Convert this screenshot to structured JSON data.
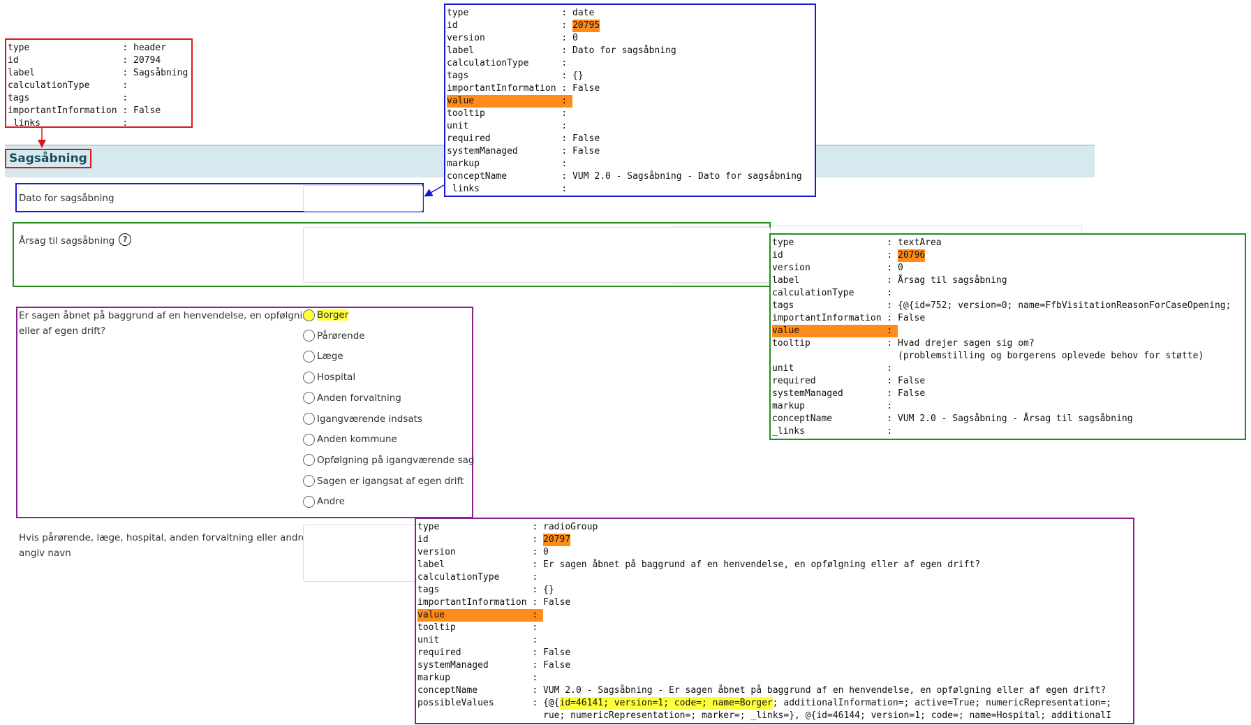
{
  "header_panel": {
    "rows": [
      {
        "k": "type",
        "v": "header"
      },
      {
        "k": "id",
        "v": "20794"
      },
      {
        "k": "label",
        "v": "Sagsåbning"
      },
      {
        "k": "calculationType",
        "v": ""
      },
      {
        "k": "tags",
        "v": ""
      },
      {
        "k": "importantInformation",
        "v": "False"
      },
      {
        "k": " links",
        "v": ""
      }
    ]
  },
  "form": {
    "header_title": "Sagsåbning",
    "date_label": "Dato for sagsåbning",
    "reason_label": "Årsag til sagsåbning",
    "help_glyph": "?",
    "question_label_1": "Er sagen åbnet på baggrund af en henvendelse, en opfølgning",
    "question_label_2": "eller af egen drift?",
    "radio_options": [
      "Borger",
      "Pårørende",
      "Læge",
      "Hospital",
      "Anden forvaltning",
      "Igangværende indsats",
      "Anden kommune",
      "Opfølgning på igangværende sag",
      "Sagen er igangsat af egen drift",
      "Andre"
    ],
    "name_label_1": "Hvis pårørende, læge, hospital, anden forvaltning eller andre -",
    "name_label_2": "angiv navn"
  },
  "date_panel": {
    "rows": [
      {
        "k": "type",
        "v": "date"
      },
      {
        "k": "id",
        "v": "20795"
      },
      {
        "k": "version",
        "v": "0"
      },
      {
        "k": "label",
        "v": "Dato for sagsåbning"
      },
      {
        "k": "calculationType",
        "v": ""
      },
      {
        "k": "tags",
        "v": "{}"
      },
      {
        "k": "importantInformation",
        "v": "False"
      },
      {
        "k": "value",
        "v": ""
      },
      {
        "k": "tooltip",
        "v": ""
      },
      {
        "k": "unit",
        "v": ""
      },
      {
        "k": "required",
        "v": "False"
      },
      {
        "k": "systemManaged",
        "v": "False"
      },
      {
        "k": "markup",
        "v": ""
      },
      {
        "k": "conceptName",
        "v": "VUM 2.0 - Sagsåbning - Dato for sagsåbning"
      },
      {
        "k": " links",
        "v": ""
      }
    ]
  },
  "textarea_panel": {
    "rows": [
      {
        "k": "type",
        "v": "textArea"
      },
      {
        "k": "id",
        "v": "20796"
      },
      {
        "k": "version",
        "v": "0"
      },
      {
        "k": "label",
        "v": "Årsag til sagsåbning"
      },
      {
        "k": "calculationType",
        "v": ""
      },
      {
        "k": "tags",
        "v": "{@{id=752; version=0; name=FfbVisitationReasonForCaseOpening;"
      },
      {
        "k": "importantInformation",
        "v": "False"
      },
      {
        "k": "value",
        "v": ""
      },
      {
        "k": "tooltip",
        "v": "Hvad drejer sagen sig om?"
      },
      {
        "k": "",
        "v": "(problemstilling og borgerens oplevede behov for støtte)"
      },
      {
        "k": "unit",
        "v": ""
      },
      {
        "k": "required",
        "v": "False"
      },
      {
        "k": "systemManaged",
        "v": "False"
      },
      {
        "k": "markup",
        "v": ""
      },
      {
        "k": "conceptName",
        "v": "VUM 2.0 - Sagsåbning - Årsag til sagsåbning"
      },
      {
        "k": "_links",
        "v": ""
      }
    ]
  },
  "radio_panel": {
    "rows": [
      {
        "k": "type",
        "v": "radioGroup"
      },
      {
        "k": "id",
        "v": "20797"
      },
      {
        "k": "version",
        "v": "0"
      },
      {
        "k": "label",
        "v": "Er sagen åbnet på baggrund af en henvendelse, en opfølgning eller af egen drift?"
      },
      {
        "k": "calculationType",
        "v": ""
      },
      {
        "k": "tags",
        "v": "{}"
      },
      {
        "k": "importantInformation",
        "v": "False"
      },
      {
        "k": "value",
        "v": ""
      },
      {
        "k": "tooltip",
        "v": ""
      },
      {
        "k": "unit",
        "v": ""
      },
      {
        "k": "required",
        "v": "False"
      },
      {
        "k": "systemManaged",
        "v": "False"
      },
      {
        "k": "markup",
        "v": ""
      },
      {
        "k": "conceptName",
        "v": "VUM 2.0 - Sagsåbning - Er sagen åbnet på baggrund af en henvendelse, en opfølgning eller af egen drift?"
      }
    ],
    "possible_key": "possibleValues",
    "possible_prefix": "{@{",
    "possible_highlight": "id=46141; version=1; code=; name=Borger",
    "possible_rest": "; additionalInformation=; active=True; numericRepresentation=;",
    "possible_line2": "rue; numericRepresentation=; marker=; _links=}, @{id=46144; version=1; code=; name=Hospital; additionalI"
  },
  "colors": {
    "red": "#e0141c",
    "blue": "#1a1ad4",
    "green": "#1e8f1e",
    "purple": "#8a1e8f",
    "orange": "#ff8c1a",
    "yellow": "#ffff3b",
    "header_bg": "#d5e9ef"
  }
}
